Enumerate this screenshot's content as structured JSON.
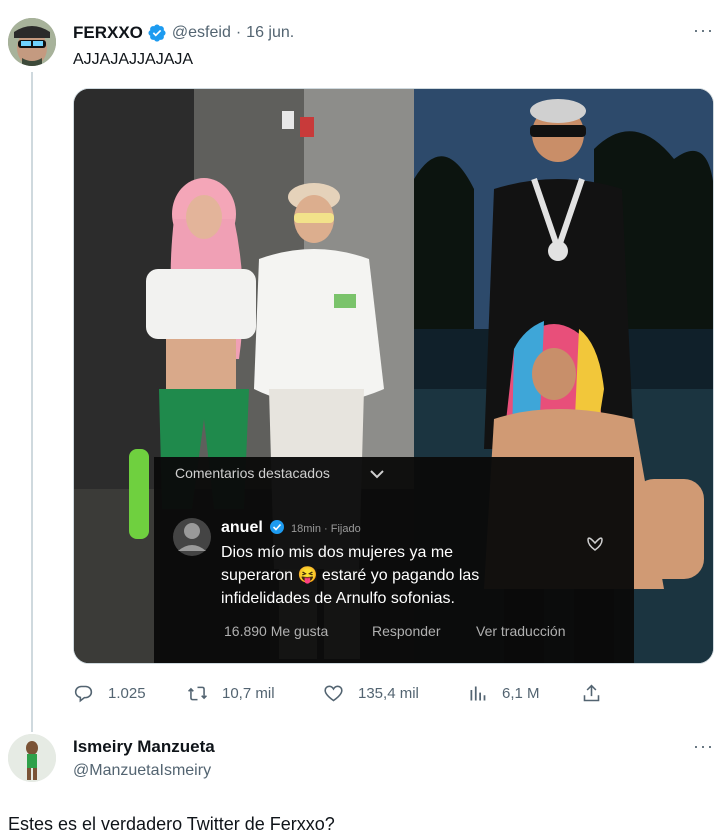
{
  "tweet": {
    "display_name": "FERXXO",
    "handle": "@esfeid",
    "date": "16 jun.",
    "text": "AJJAJAJJAJAJA",
    "more_label": "···"
  },
  "media": {
    "header": "Comentarios destacados",
    "comment_user": "anuel",
    "comment_meta": "18min · Fijado",
    "comment_lines": [
      "Dios mío mis dos mujeres ya me",
      "superaron 😝 estaré yo pagando las",
      "infidelidades de Arnulfo sofonias."
    ],
    "likes": "16.890 Me gusta",
    "reply": "Responder",
    "translate": "Ver traducción"
  },
  "actions": {
    "replies": "1.025",
    "retweets": "10,7 mil",
    "likes": "135,4 mil",
    "views": "6,1 M"
  },
  "reply": {
    "display_name": "Ismeiry Manzueta",
    "handle": "@ManzuetaIsmeiry",
    "text": "Estes es el verdadero Twitter de Ferxxo?",
    "more_label": "···"
  },
  "colors": {
    "verified": "#1d9bf0",
    "secondary_text": "#536471",
    "primary_text": "#0f1419",
    "divider": "#cfd9de"
  }
}
